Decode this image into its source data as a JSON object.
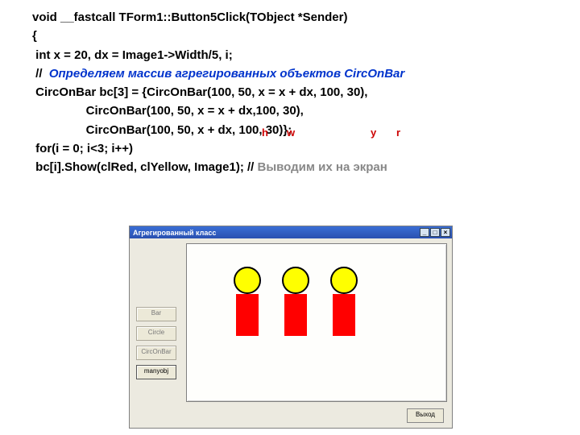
{
  "code": {
    "l1a": "void __fastcall TForm1::Button5Click(TObject *Sender)",
    "l2": "{",
    "l3": " int x = 20, dx = Image1->Width/5, i;",
    "l4a": " // ",
    "l4b": " Определяем массив агрегированных объектов CircOnBar",
    "l5": " CircOnBar bc[3] = {CircOnBar(100, 50, x = x + dx, 100, 30),",
    "l6": "                CircOnBar(100, 50, x = x + dx,100, 30),",
    "l7": "                CircOnBar(100, 50, x + dx, 100, 30)};",
    "l8": " for(i = 0; i<3; i++)",
    "l9a": " bc[i].Show(clRed, clYellow, Image1);",
    "l9b": " // ",
    "l9c": "Выводим их на экран"
  },
  "ann": {
    "h": "h",
    "w": "w",
    "y": "y",
    "r": "r"
  },
  "window": {
    "title": "Агрегированный класс",
    "min": "_",
    "max": "□",
    "close": "×",
    "btn1": "Bar",
    "btn2": "Circle",
    "btn3": "CircOnBar",
    "btn4": "manyobj",
    "exit": "Выход"
  }
}
